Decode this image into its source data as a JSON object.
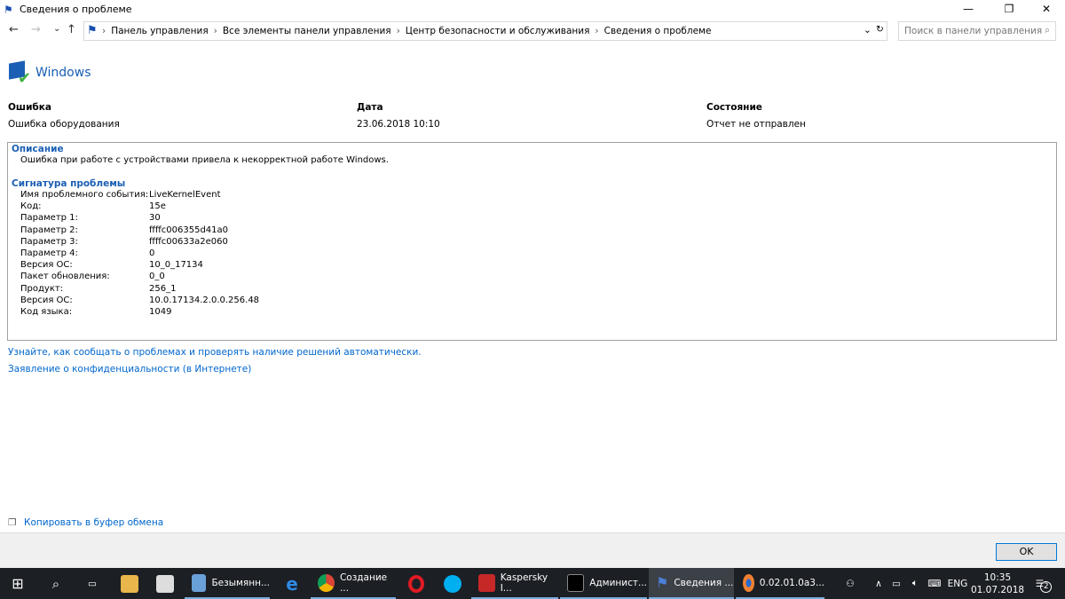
{
  "window": {
    "title": "Сведения о проблеме",
    "minimize": "—",
    "maximize": "❐",
    "close": "✕"
  },
  "address": {
    "back": "←",
    "forward": "→",
    "recent": "⌄",
    "up": "↑",
    "crumbs": [
      "Панель управления",
      "Все элементы панели управления",
      "Центр безопасности и обслуживания",
      "Сведения о проблеме"
    ],
    "search_placeholder": "Поиск в панели управления"
  },
  "header": {
    "product": "Windows"
  },
  "summary": {
    "labels": [
      "Ошибка",
      "Дата",
      "Состояние"
    ],
    "values": [
      "Ошибка оборудования",
      "23.06.2018 10:10",
      "Отчет не отправлен"
    ]
  },
  "description": {
    "title": "Описание",
    "text": "Ошибка при работе с устройствами привела к некорректной работе Windows."
  },
  "signature": {
    "title": "Сигнатура проблемы",
    "rows": [
      {
        "k": "Имя проблемного события:",
        "v": "LiveKernelEvent"
      },
      {
        "k": "Код:",
        "v": "15e"
      },
      {
        "k": "Параметр 1:",
        "v": "30"
      },
      {
        "k": "Параметр 2:",
        "v": "ffffc006355d41a0"
      },
      {
        "k": "Параметр 3:",
        "v": "ffffc00633a2e060"
      },
      {
        "k": "Параметр 4:",
        "v": "0"
      },
      {
        "k": "Версия ОС:",
        "v": "10_0_17134"
      },
      {
        "k": "Пакет обновления:",
        "v": "0_0"
      },
      {
        "k": "Продукт:",
        "v": "256_1"
      },
      {
        "k": "Версия ОС:",
        "v": "10.0.17134.2.0.0.256.48"
      },
      {
        "k": "Код языка:",
        "v": "1049"
      }
    ]
  },
  "links": {
    "learn": "Узнайте, как сообщать о проблемах и проверять наличие решений автоматически.",
    "privacy": "Заявление о конфиденциальности (в Интернете)",
    "copy": "Копировать в буфер обмена"
  },
  "ok": "OK",
  "taskbar": {
    "apps": [
      "Безымянн...",
      "Создание ...",
      "Kaspersky I...",
      "Админист...",
      "Сведения ...",
      "0.02.01.0a3..."
    ],
    "lang": "ENG",
    "time": "10:35",
    "date": "01.07.2018",
    "notifications": "2"
  }
}
